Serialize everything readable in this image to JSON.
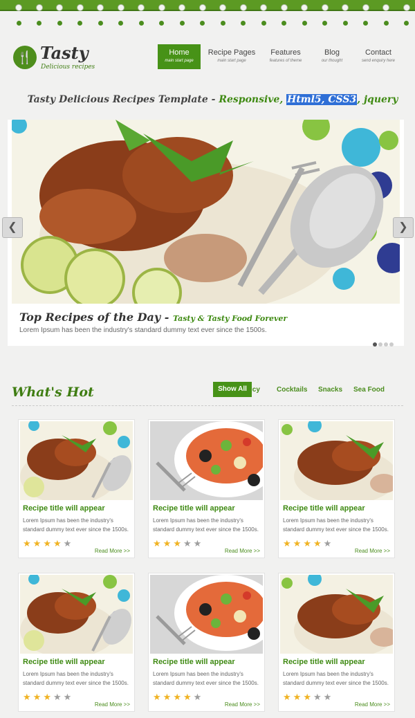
{
  "logo": {
    "name": "Tasty",
    "tagline": "Delicious recipes",
    "icon": "fork-knife-icon"
  },
  "nav": [
    {
      "label": "Home",
      "sub": "main start page",
      "active": true
    },
    {
      "label": "Recipe Pages",
      "sub": "main start page",
      "active": false
    },
    {
      "label": "Features",
      "sub": "features of theme",
      "active": false
    },
    {
      "label": "Blog",
      "sub": "our thought",
      "active": false
    },
    {
      "label": "Contact",
      "sub": "send enquiry here",
      "active": false
    }
  ],
  "tagline": {
    "part1": "Tasty Delicious Recipes Template - ",
    "part2": "Responsive, ",
    "highlight": "Html5, CSS3",
    "part3": ", jquery"
  },
  "slider": {
    "title": "Top Recipes of the Day - ",
    "subtitle": "Tasty & Tasty Food Forever",
    "text": "Lorem Ipsum has been the industry's standard dummy text ever since the 1500s.",
    "prev_icon": "chevron-left-icon",
    "next_icon": "chevron-right-icon",
    "active_dot": 0,
    "dot_count": 4
  },
  "hot": {
    "title": "What's Hot",
    "tabs": [
      "Show All",
      "icy",
      "Cocktails",
      "Snacks",
      "Sea Food"
    ]
  },
  "cards": [
    {
      "title": "Recipe title will appear",
      "text": "Lorem Ipsum has been the industry's standard dummy text ever since the 1500s.",
      "rating": 4,
      "more": "Read More >>",
      "image": "pork-rice"
    },
    {
      "title": "Recipe title will appear",
      "text": "Lorem Ipsum has been the industry's standard dummy text ever since the 1500s.",
      "rating": 3,
      "more": "Read More >>",
      "image": "salad"
    },
    {
      "title": "Recipe title will appear",
      "text": "Lorem Ipsum has been the industry's standard dummy text ever since the 1500s.",
      "rating": 4,
      "more": "Read More >>",
      "image": "pork-rice-2"
    },
    {
      "title": "Recipe title will appear",
      "text": "Lorem Ipsum has been the industry's standard dummy text ever since the 1500s.",
      "rating": 3,
      "more": "Read More >>",
      "image": "pork-rice"
    },
    {
      "title": "Recipe title will appear",
      "text": "Lorem Ipsum has been the industry's standard dummy text ever since the 1500s.",
      "rating": 4,
      "more": "Read More >>",
      "image": "salad"
    },
    {
      "title": "Recipe title will appear",
      "text": "Lorem Ipsum has been the industry's standard dummy text ever since the 1500s.",
      "rating": 3,
      "more": "Read More >>",
      "image": "pork-rice-2"
    }
  ],
  "colors": {
    "brand_green": "#479217",
    "text_green": "#3f8a13",
    "star": "#f0b323"
  }
}
